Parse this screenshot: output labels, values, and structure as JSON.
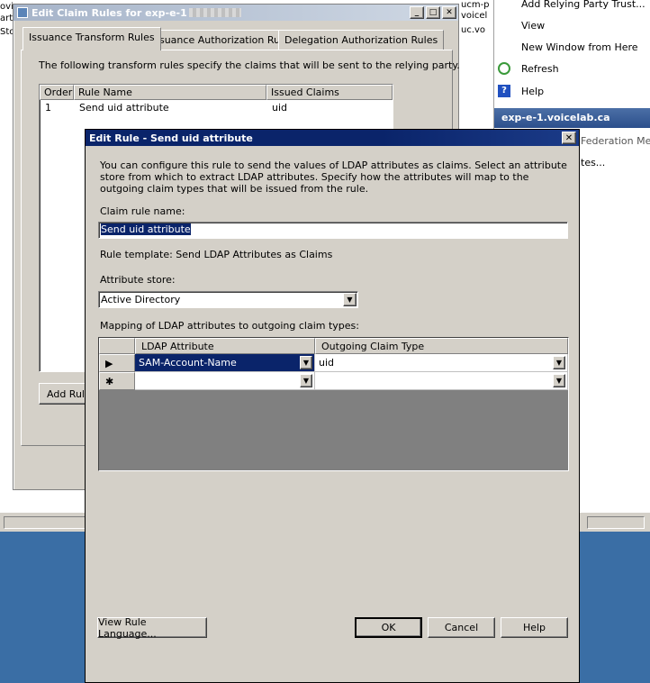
{
  "background": {
    "left_slivers": [
      "ovi",
      "art",
      "Sto"
    ],
    "middle_slivers": [
      "ucm-p",
      "voicel",
      "uc.vo"
    ],
    "actions": [
      {
        "label": "Add Relying Party Trust...",
        "icon": "none"
      },
      {
        "label": "View",
        "icon": "none"
      },
      {
        "label": "New Window from Here",
        "icon": "none"
      },
      {
        "label": "Refresh",
        "icon": "refresh-icon"
      },
      {
        "label": "Help",
        "icon": "help-icon"
      }
    ],
    "section_title": "exp-e-1.voicelab.ca",
    "section_text": "Federation Meta",
    "section_ellipsis": "tes..."
  },
  "claim_window": {
    "title": "Edit Claim Rules for exp-e-1",
    "tabs": [
      "Issuance Transform Rules",
      "Issuance Authorization Rules",
      "Delegation Authorization Rules"
    ],
    "description": "The following transform rules specify the claims that will be sent to the relying party.",
    "columns": [
      "Order",
      "Rule Name",
      "Issued Claims"
    ],
    "rows": [
      {
        "order": "1",
        "name": "Send uid attribute",
        "claims": "uid"
      }
    ],
    "add_rule_label": "Add Rule"
  },
  "edit_dialog": {
    "title": "Edit Rule - Send uid attribute",
    "intro": "You can configure this rule to send the values of LDAP attributes as claims. Select an attribute store from which to extract LDAP attributes. Specify how the attributes will map to the outgoing claim types that will be issued from the rule.",
    "claim_rule_name_label": "Claim rule name:",
    "claim_rule_name_value": "Send uid attribute",
    "rule_template": "Rule template: Send LDAP Attributes as Claims",
    "attribute_store_label": "Attribute store:",
    "attribute_store_value": "Active Directory",
    "mapping_label": "Mapping of LDAP attributes to outgoing claim types:",
    "grid_headers": [
      "LDAP Attribute",
      "Outgoing Claim Type"
    ],
    "grid_rows": [
      {
        "marker": "▶",
        "ldap": "SAM-Account-Name",
        "claim": "uid"
      },
      {
        "marker": "✱",
        "ldap": "",
        "claim": ""
      }
    ],
    "buttons": {
      "view_rule_language": "View Rule Language...",
      "ok": "OK",
      "cancel": "Cancel",
      "help": "Help"
    }
  }
}
